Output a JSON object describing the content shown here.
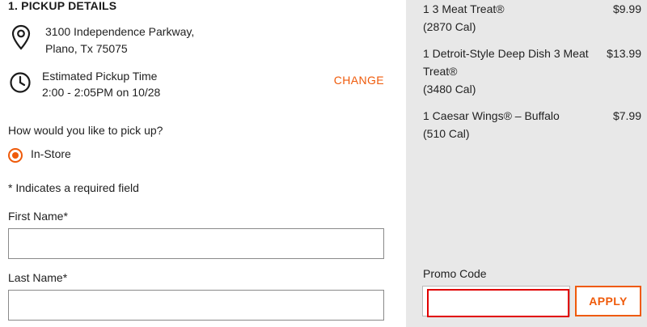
{
  "pickup": {
    "section_title": "1. PICKUP DETAILS",
    "address_line1": "3100 Independence Parkway,",
    "address_line2": "Plano, Tx 75075",
    "estimated_label": "Estimated Pickup Time",
    "estimated_value": "2:00 - 2:05PM on 10/28",
    "change_label": "CHANGE",
    "question": "How would you like to pick up?",
    "option_label": "In-Store",
    "option_selected": true,
    "icons": {
      "location": "map-pin-icon",
      "time": "clock-icon"
    }
  },
  "form": {
    "required_note": "* Indicates a required field",
    "first_name_label": "First Name*",
    "first_name_value": "",
    "last_name_label": "Last Name*",
    "last_name_value": ""
  },
  "order": {
    "items": [
      {
        "name": "1 3 Meat Treat®",
        "cal": "(2870 Cal)",
        "price": "$9.99"
      },
      {
        "name": "1 Detroit-Style Deep Dish 3 Meat Treat®",
        "cal": "(3480 Cal)",
        "price": "$13.99"
      },
      {
        "name": "1 Caesar Wings® – Buffalo",
        "cal": "(510 Cal)",
        "price": "$7.99"
      }
    ],
    "promo_label": "Promo Code",
    "promo_value": "",
    "apply_label": "APPLY"
  },
  "colors": {
    "accent": "#ef5a0a",
    "sidebar_bg": "#e8e8e8",
    "highlight": "#e10000"
  }
}
